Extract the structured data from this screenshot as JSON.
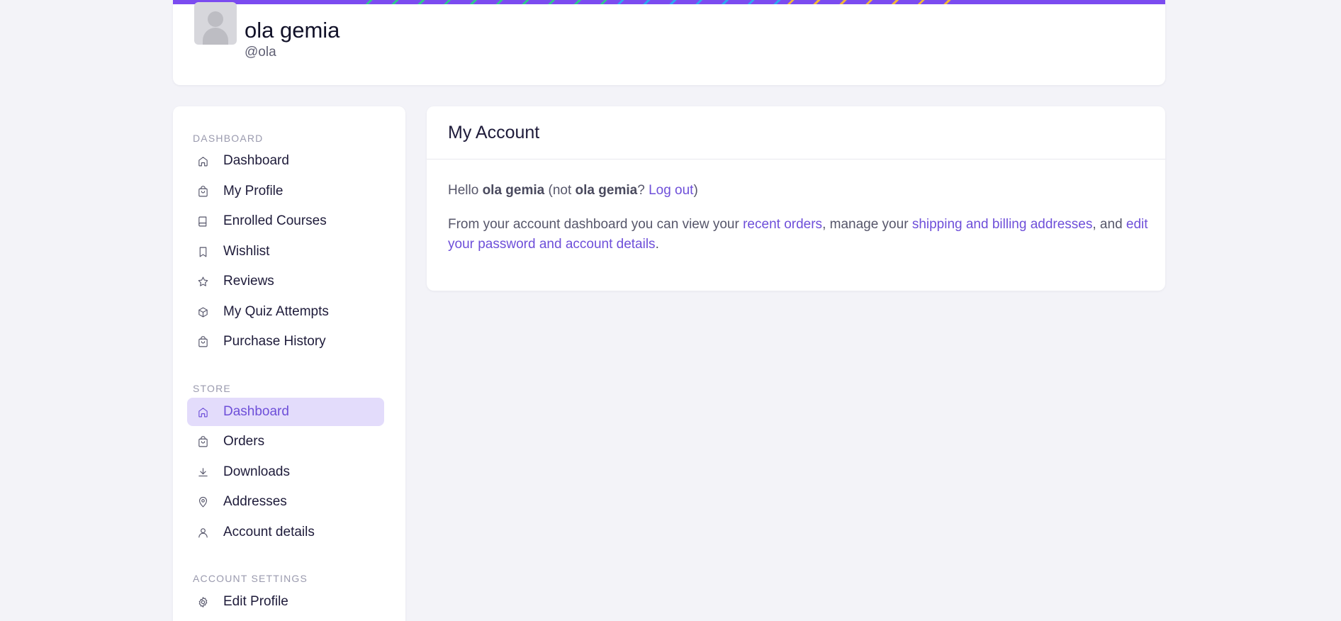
{
  "profile": {
    "name": "ola gemia",
    "handle": "@ola"
  },
  "sidebar": {
    "sections": [
      {
        "title": "DASHBOARD",
        "items": [
          {
            "label": "Dashboard",
            "icon": "home-icon"
          },
          {
            "label": "My Profile",
            "icon": "bag-icon"
          },
          {
            "label": "Enrolled Courses",
            "icon": "book-icon"
          },
          {
            "label": "Wishlist",
            "icon": "bookmark-icon"
          },
          {
            "label": "Reviews",
            "icon": "star-icon"
          },
          {
            "label": "My Quiz Attempts",
            "icon": "cube-icon"
          },
          {
            "label": "Purchase History",
            "icon": "bag-icon"
          }
        ]
      },
      {
        "title": "STORE",
        "items": [
          {
            "label": "Dashboard",
            "icon": "home-icon",
            "active": true
          },
          {
            "label": "Orders",
            "icon": "bag-icon"
          },
          {
            "label": "Downloads",
            "icon": "download-icon"
          },
          {
            "label": "Addresses",
            "icon": "location-pin-icon"
          },
          {
            "label": "Account details",
            "icon": "user-icon"
          }
        ]
      },
      {
        "title": "ACCOUNT SETTINGS",
        "items": [
          {
            "label": "Edit Profile",
            "icon": "gear-icon"
          }
        ]
      }
    ]
  },
  "account": {
    "title": "My Account",
    "hello_prefix": "Hello ",
    "user_name": "ola gemia",
    "not_prefix": " (not ",
    "user_name_again": "ola gemia",
    "question": "? ",
    "logout_link": "Log out",
    "close_paren": ")",
    "intro_text": "From your account dashboard you can view your ",
    "recent_orders_link": "recent orders",
    "manage_text": ", manage your ",
    "addresses_link": "shipping and billing addresses",
    "and_text": ", and ",
    "edit_link": "edit your password and account details",
    "end_text": "."
  },
  "colors": {
    "accent": "#6e4fd9",
    "active_bg": "#e3dcfb",
    "cover": "#7b4bf0",
    "page_bg": "#f3f3f8"
  }
}
